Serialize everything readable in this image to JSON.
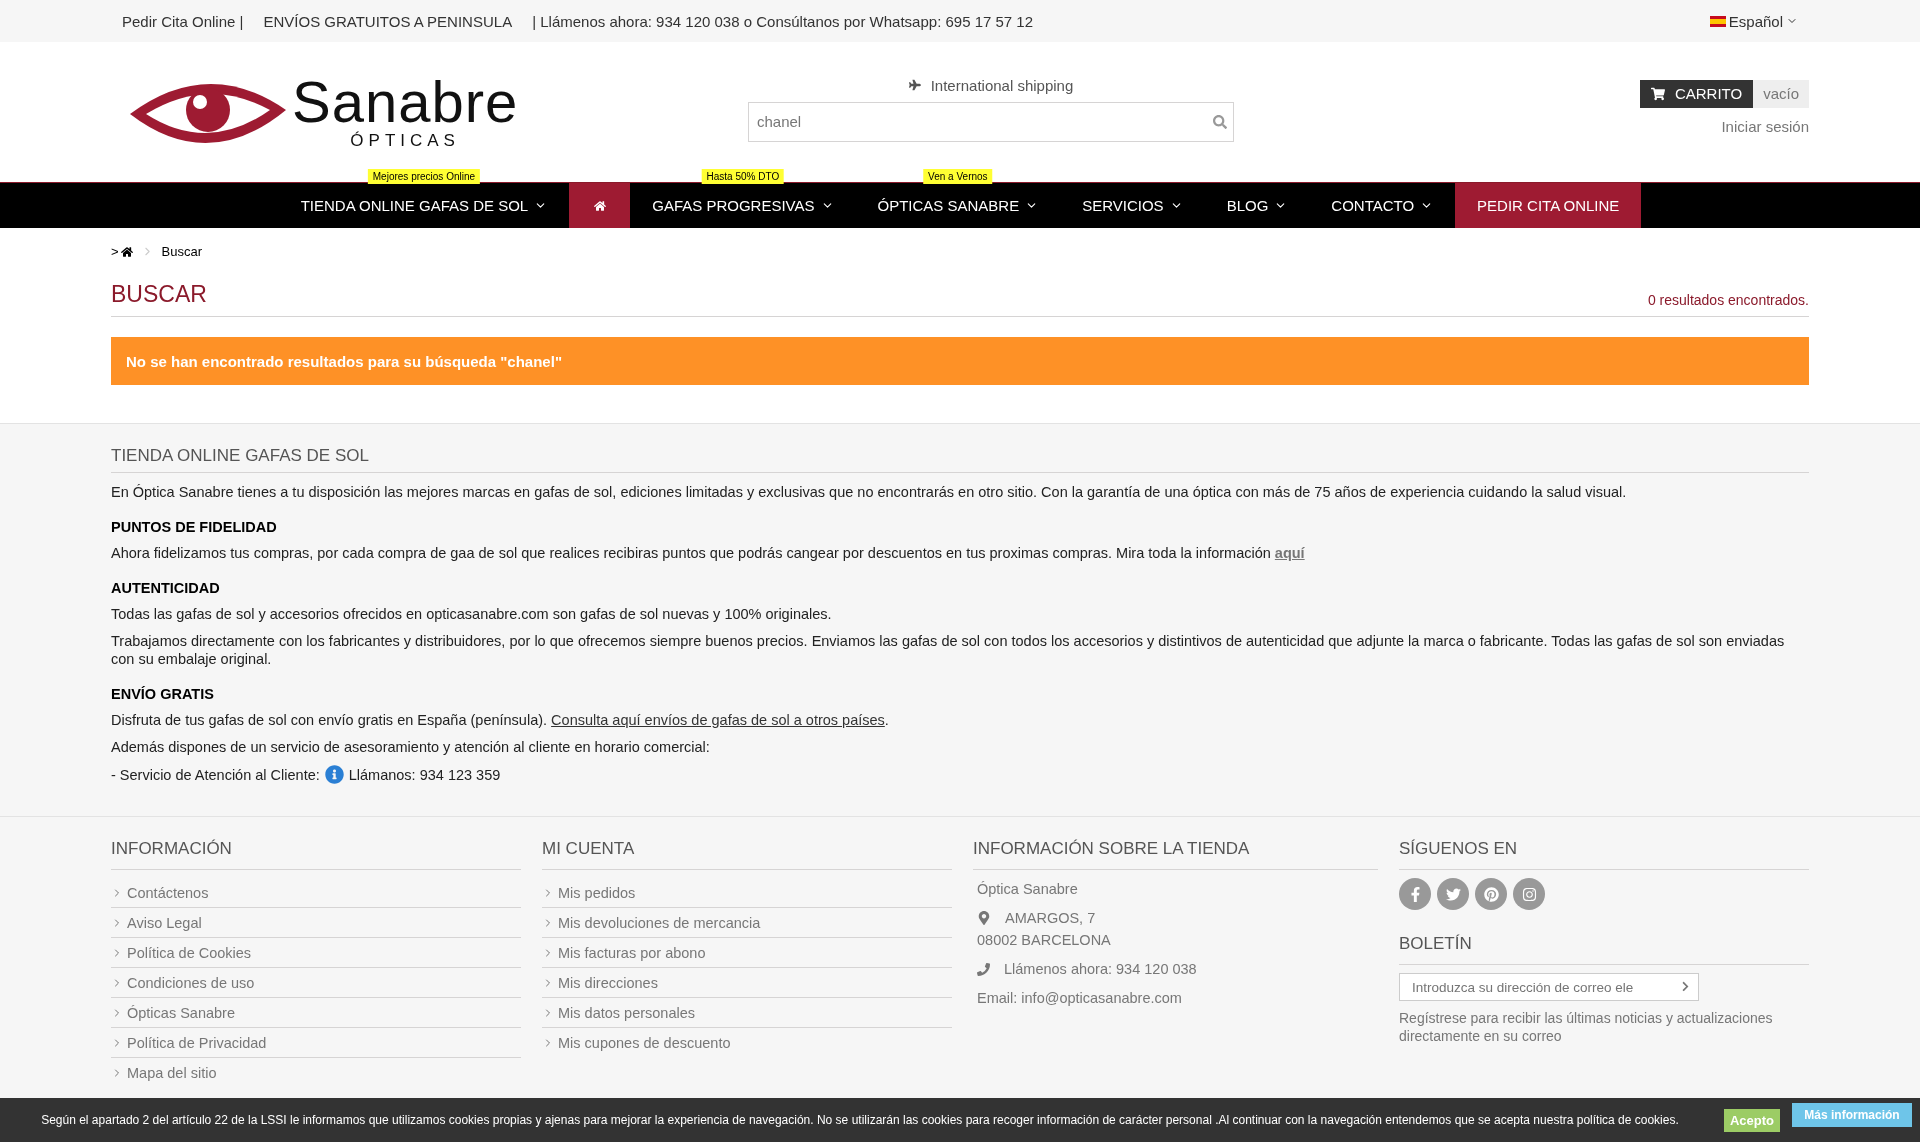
{
  "top_bar": {
    "items": [
      "Pedir Cita Online |",
      "ENVÍOS GRATUITOS A PENINSULA",
      "| Llámenos ahora: 934 120 038 o Consúltanos por Whatsapp: 695 17 57 12"
    ],
    "language": "Español"
  },
  "header": {
    "logo": {
      "name": "Sanabre",
      "subtitle": "ÓPTICAS"
    },
    "shipping": "International shipping",
    "search": {
      "value": "chanel"
    },
    "cart": {
      "label": "CARRITO",
      "status": "vacío"
    },
    "login": "Iniciar sesión"
  },
  "nav": [
    {
      "kind": "menu",
      "label": "TIENDA ONLINE GAFAS DE SOL",
      "badge": "Mejores precios Online"
    },
    {
      "kind": "home"
    },
    {
      "kind": "menu",
      "label": "GAFAS PROGRESIVAS",
      "badge": "Hasta 50% DTO"
    },
    {
      "kind": "menu",
      "label": "ÓPTICAS SANABRE",
      "badge": "Ven a Vernos"
    },
    {
      "kind": "menu",
      "label": "SERVICIOS"
    },
    {
      "kind": "menu",
      "label": "BLOG"
    },
    {
      "kind": "menu",
      "label": "CONTACTO"
    },
    {
      "kind": "cta",
      "label": "PEDIR CITA ONLINE"
    }
  ],
  "breadcrumb": {
    "prefix": ">",
    "current": "Buscar"
  },
  "page": {
    "title": "BUSCAR",
    "count": "0 resultados encontrados.",
    "alert": "No se han encontrado resultados para su búsqueda \"chanel\""
  },
  "info": {
    "title": "TIENDA ONLINE GAFAS DE SOL",
    "blocks": [
      {
        "kind": "para",
        "text": "En Óptica Sanabre tienes a tu disposición las mejores marcas en gafas de sol, ediciones limitadas y exclusivas que no encontrarás en otro sitio. Con la garantía de una óptica con más de 75 años de experiencia cuidando la salud visual."
      },
      {
        "kind": "heading",
        "text": "PUNTOS DE FIDELIDAD"
      },
      {
        "kind": "para",
        "text": "Ahora fidelizamos tus compras, por cada compra de gaa de sol que realices recibiras puntos que podrás cangear por descuentos en tus proximas compras. Mira toda la información",
        "link": "aquí"
      },
      {
        "kind": "heading",
        "text": "AUTENTICIDAD"
      },
      {
        "kind": "para",
        "text": "Todas las gafas de sol y accesorios ofrecidos en opticasanabre.com son gafas de sol nuevas y 100% originales."
      },
      {
        "kind": "para",
        "text": "Trabajamos directamente con los fabricantes y distribuidores, por lo que ofrecemos siempre buenos precios. Enviamos las gafas de sol con todos los accesorios y distintivos de autenticidad que adjunte la marca o fabricante. Todas las gafas de sol son enviadas con su embalaje original."
      },
      {
        "kind": "heading",
        "text": "ENVÍO GRATIS"
      },
      {
        "kind": "para",
        "text": "Disfruta de tus gafas de sol con envío gratis en España (península).",
        "link": "Consulta aquí envíos de gafas de sol a otros países",
        "after": "."
      },
      {
        "kind": "para",
        "text": "Además dispones de un servicio de asesoramiento y atención al cliente en horario comercial:"
      },
      {
        "kind": "service",
        "text": "- Servicio de Atención al Cliente:",
        "after": "Llámanos: 934 123 359"
      }
    ]
  },
  "footer": {
    "information": {
      "title": "INFORMACIÓN",
      "links": [
        "Contáctenos",
        "Aviso Legal",
        "Política de Cookies",
        "Condiciones de uso",
        "Ópticas Sanabre",
        "Política de Privacidad",
        "Mapa del sitio"
      ]
    },
    "account": {
      "title": "MI CUENTA",
      "links": [
        "Mis pedidos",
        "Mis devoluciones de mercancia",
        "Mis facturas por abono",
        "Mis direcciones",
        "Mis datos personales",
        "Mis cupones de descuento"
      ]
    },
    "store": {
      "title": "INFORMACIÓN SOBRE LA TIENDA",
      "name": "Óptica Sanabre",
      "address": [
        "AMARGOS, 7",
        "08002 BARCELONA"
      ],
      "phone": "Llámenos ahora: 934 120 038",
      "email": "Email: info@opticasanabre.com"
    },
    "social": {
      "title": "SÍGUENOS EN",
      "networks": [
        {
          "kind": "facebook"
        },
        {
          "kind": "twitter"
        },
        {
          "kind": "pinterest"
        },
        {
          "kind": "instagram"
        }
      ]
    },
    "newsletter": {
      "title": "BOLETÍN",
      "placeholder": "Introduzca su dirección de correo ele",
      "note": "Regístrese para recibir las últimas noticias y actualizaciones directamente en su correo"
    }
  },
  "cookie_bar": {
    "text": "Según el apartado 2 del artículo 22 de la LSSI le informamos que utilizamos cookies propias y ajenas para mejorar la experiencia de navegación. No se utilizarán las cookies para recoger información de carácter personal .Al continuar con la navegación entendemos que se acepta nuestra política de cookies.",
    "accept": "Acepto",
    "more": "Más información"
  }
}
